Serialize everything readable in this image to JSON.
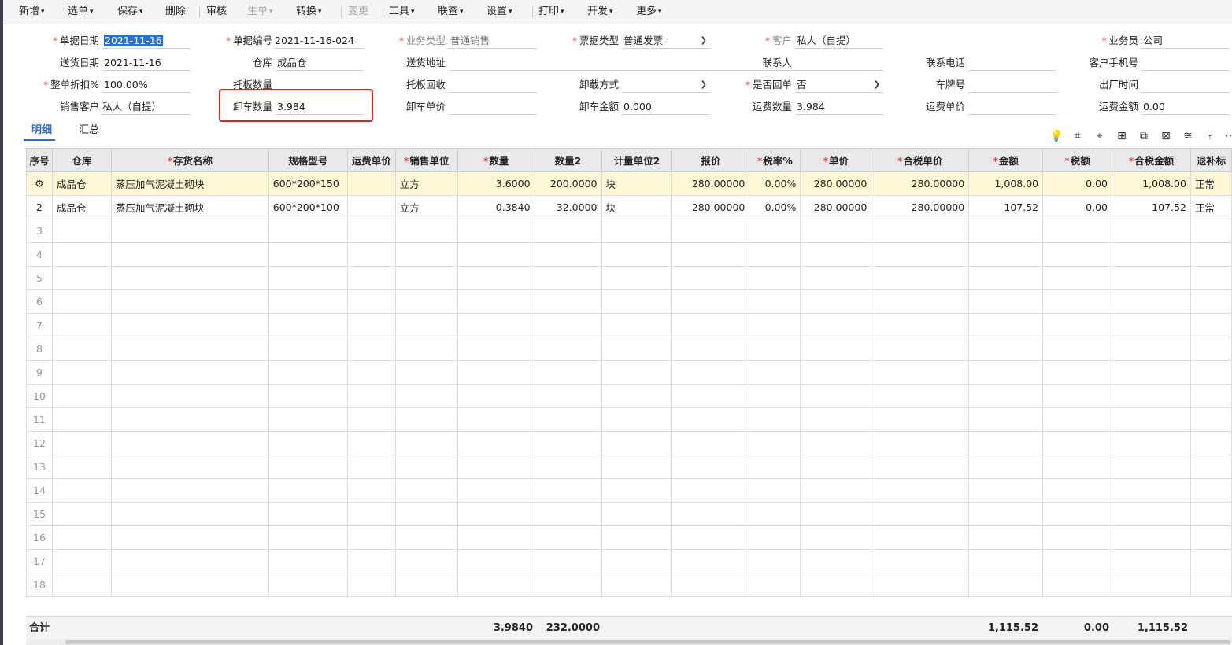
{
  "toolbar": [
    {
      "label": "新增",
      "caret": true,
      "disabled": false
    },
    {
      "label": "选单",
      "caret": true,
      "disabled": false
    },
    {
      "label": "保存",
      "caret": true,
      "disabled": false
    },
    {
      "label": "删除",
      "caret": false,
      "disabled": false
    },
    {
      "label": "审核",
      "caret": false,
      "disabled": false
    },
    {
      "label": "生单",
      "caret": true,
      "disabled": true
    },
    {
      "label": "转换",
      "caret": true,
      "disabled": false
    },
    {
      "label": "变更",
      "caret": false,
      "disabled": true
    },
    {
      "label": "工具",
      "caret": true,
      "disabled": false
    },
    {
      "label": "联查",
      "caret": true,
      "disabled": false
    },
    {
      "label": "设置",
      "caret": true,
      "disabled": false
    },
    {
      "label": "打印",
      "caret": true,
      "disabled": false
    },
    {
      "label": "开发",
      "caret": true,
      "disabled": false
    },
    {
      "label": "更多",
      "caret": true,
      "disabled": false
    }
  ],
  "form": {
    "doc_date": {
      "label": "单据日期",
      "value": "2021-11-16"
    },
    "doc_no": {
      "label": "单据编号",
      "value": "2021-11-16-024"
    },
    "biz_type": {
      "label": "业务类型",
      "value": "普通销售"
    },
    "invoice_type": {
      "label": "票据类型",
      "value": "普通发票"
    },
    "customer": {
      "label": "客户",
      "value": "私人（自提）"
    },
    "salesman": {
      "label": "业务员",
      "value": "公司"
    },
    "delivery_date": {
      "label": "送货日期",
      "value": "2021-11-16"
    },
    "warehouse": {
      "label": "仓库",
      "value": "成品仓"
    },
    "delivery_addr": {
      "label": "送货地址",
      "value": ""
    },
    "contact": {
      "label": "联系人",
      "value": ""
    },
    "contact_phone": {
      "label": "联系电话",
      "value": ""
    },
    "customer_mobile": {
      "label": "客户手机号",
      "value": ""
    },
    "discount": {
      "label": "整单折扣%",
      "value": "100.00%"
    },
    "pallet_qty": {
      "label": "托板数量",
      "value": ""
    },
    "pallet_return": {
      "label": "托板回收",
      "value": ""
    },
    "unload_method": {
      "label": "卸载方式",
      "value": ""
    },
    "is_return": {
      "label": "是否回单",
      "value": "否"
    },
    "plate_no": {
      "label": "车牌号",
      "value": ""
    },
    "leave_time": {
      "label": "出厂时间",
      "value": ""
    },
    "sales_customer": {
      "label": "销售客户",
      "value": "私人（自提）"
    },
    "unload_qty": {
      "label": "卸车数量",
      "value": "3.984"
    },
    "unload_price": {
      "label": "卸车单价",
      "value": ""
    },
    "unload_amount": {
      "label": "卸车金额",
      "value": "0.000"
    },
    "freight_qty": {
      "label": "运费数量",
      "value": "3.984"
    },
    "freight_price": {
      "label": "运费单价",
      "value": ""
    },
    "freight_amount": {
      "label": "运费金额",
      "value": "0.00"
    }
  },
  "tabs": [
    "明细",
    "汇总"
  ],
  "table": {
    "headers": [
      {
        "label": "序号",
        "req": false
      },
      {
        "label": "仓库",
        "req": false
      },
      {
        "label": "存货名称",
        "req": true
      },
      {
        "label": "规格型号",
        "req": false
      },
      {
        "label": "运费单价",
        "req": false
      },
      {
        "label": "销售单位",
        "req": true
      },
      {
        "label": "数量",
        "req": true
      },
      {
        "label": "数量2",
        "req": false
      },
      {
        "label": "计量单位2",
        "req": false
      },
      {
        "label": "报价",
        "req": false
      },
      {
        "label": "税率%",
        "req": true
      },
      {
        "label": "单价",
        "req": true
      },
      {
        "label": "合税单价",
        "req": true
      },
      {
        "label": "金额",
        "req": true
      },
      {
        "label": "税额",
        "req": true
      },
      {
        "label": "合税金额",
        "req": true
      },
      {
        "label": "退补标",
        "req": false
      }
    ],
    "rows": [
      {
        "idx": "",
        "warehouse": "成品仓",
        "name": "蒸压加气泥凝土砌块",
        "spec": "600*200*150",
        "freight": "",
        "unit": "立方",
        "qty": "3.6000",
        "qty2": "200.0000",
        "unit2": "块",
        "quote": "280.00000",
        "tax_rate": "0.00%",
        "price": "280.00000",
        "tax_price": "280.00000",
        "amount": "1,008.00",
        "tax": "0.00",
        "tax_amount": "1,008.00",
        "flag": "正常"
      },
      {
        "idx": "2",
        "warehouse": "成品仓",
        "name": "蒸压加气泥凝土砌块",
        "spec": "600*200*100",
        "freight": "",
        "unit": "立方",
        "qty": "0.3840",
        "qty2": "32.0000",
        "unit2": "块",
        "quote": "280.00000",
        "tax_rate": "0.00%",
        "price": "280.00000",
        "tax_price": "280.00000",
        "amount": "107.52",
        "tax": "0.00",
        "tax_amount": "107.52",
        "flag": "正常"
      }
    ],
    "empty_rows": [
      "3",
      "4",
      "5",
      "6",
      "7",
      "8",
      "9",
      "10",
      "11",
      "12",
      "13",
      "14",
      "15",
      "16",
      "17",
      "18"
    ]
  },
  "footer": {
    "label": "合计",
    "qty": "3.9840",
    "qty2": "232.0000",
    "amount": "1,115.52",
    "tax": "0.00",
    "tax_amount": "1,115.52"
  }
}
